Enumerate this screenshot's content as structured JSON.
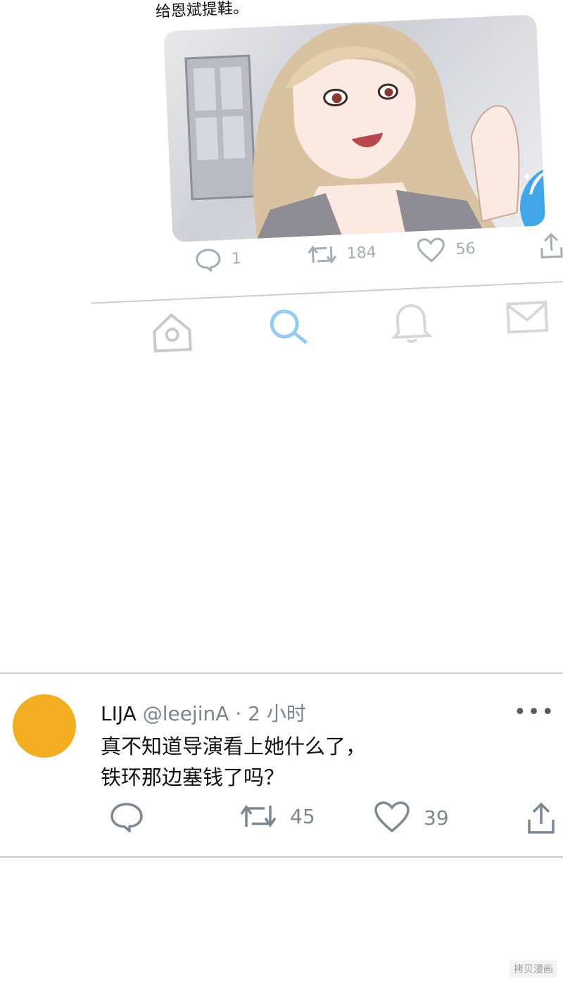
{
  "top_tweet": {
    "text": "给恩斌提鞋。",
    "actions": {
      "reply_count": "1",
      "retweet_count": "184",
      "like_count": "56"
    },
    "icons": {
      "reply": "reply-icon",
      "retweet": "retweet-icon",
      "like": "heart-icon",
      "share": "share-icon",
      "compose": "compose-feather-icon"
    }
  },
  "tab_bar": {
    "tabs": [
      {
        "icon": "home-icon"
      },
      {
        "icon": "search-icon",
        "active": true
      },
      {
        "icon": "bell-icon"
      },
      {
        "icon": "mail-icon"
      }
    ]
  },
  "tweet": {
    "name": "LIJA",
    "handle": "@leejinA",
    "separator": "·",
    "time": "2 小时",
    "more": "•••",
    "lines": [
      "真不知道导演看上她什么了，",
      "铁环那边塞钱了吗？"
    ],
    "actions": {
      "retweet_count": "45",
      "like_count": "39"
    },
    "colors": {
      "avatar": "#f2ad22",
      "accent": "#3aa3e8"
    }
  },
  "watermark": "拷贝漫画"
}
